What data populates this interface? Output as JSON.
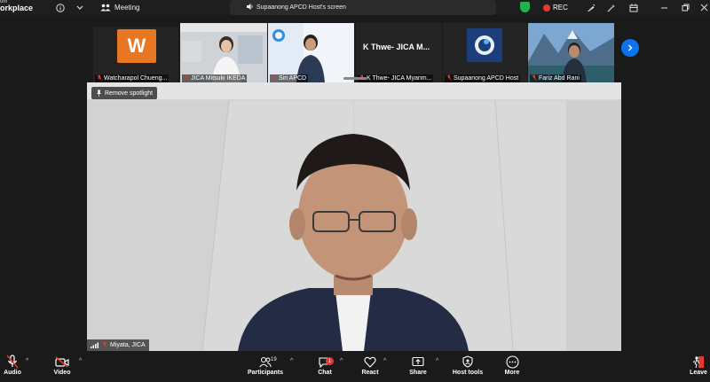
{
  "titlebar": {
    "brand_top": "om",
    "brand_main": "orkplace",
    "meeting_label": "Meeting",
    "share_status": "Supaanong APCD Host's screen",
    "rec_label": "REC"
  },
  "thumbnails": [
    {
      "name": "Watcharapol Chueng...",
      "muted": true,
      "avatar_letter": "W",
      "avatar_color": "#e87722"
    },
    {
      "name": "JICA Mitsuki IKEDA",
      "muted": true
    },
    {
      "name": "Siri APCD",
      "muted": true
    },
    {
      "name": "K Thwe- JICA Myanm...",
      "muted": true,
      "display_name": "K Thwe- JICA M..."
    },
    {
      "name": "Supaanong APCD Host",
      "muted": true
    },
    {
      "name": "Fariz Abd Rani",
      "muted": true
    }
  ],
  "main_video": {
    "spotlight_label": "Remove spotlight",
    "participant_name": "Miyata, JICA"
  },
  "toolbar": {
    "audio": "Audio",
    "video": "Video",
    "participants": "Participants",
    "participant_count": "19",
    "chat": "Chat",
    "chat_badge": "1",
    "react": "React",
    "share": "Share",
    "host_tools": "Host tools",
    "more": "More",
    "leave": "Leave"
  },
  "colors": {
    "accent_blue": "#0e72ed",
    "muted_red": "#e53935",
    "toolbar_bg": "#1a1a1a",
    "shield_green": "#22b14c"
  }
}
